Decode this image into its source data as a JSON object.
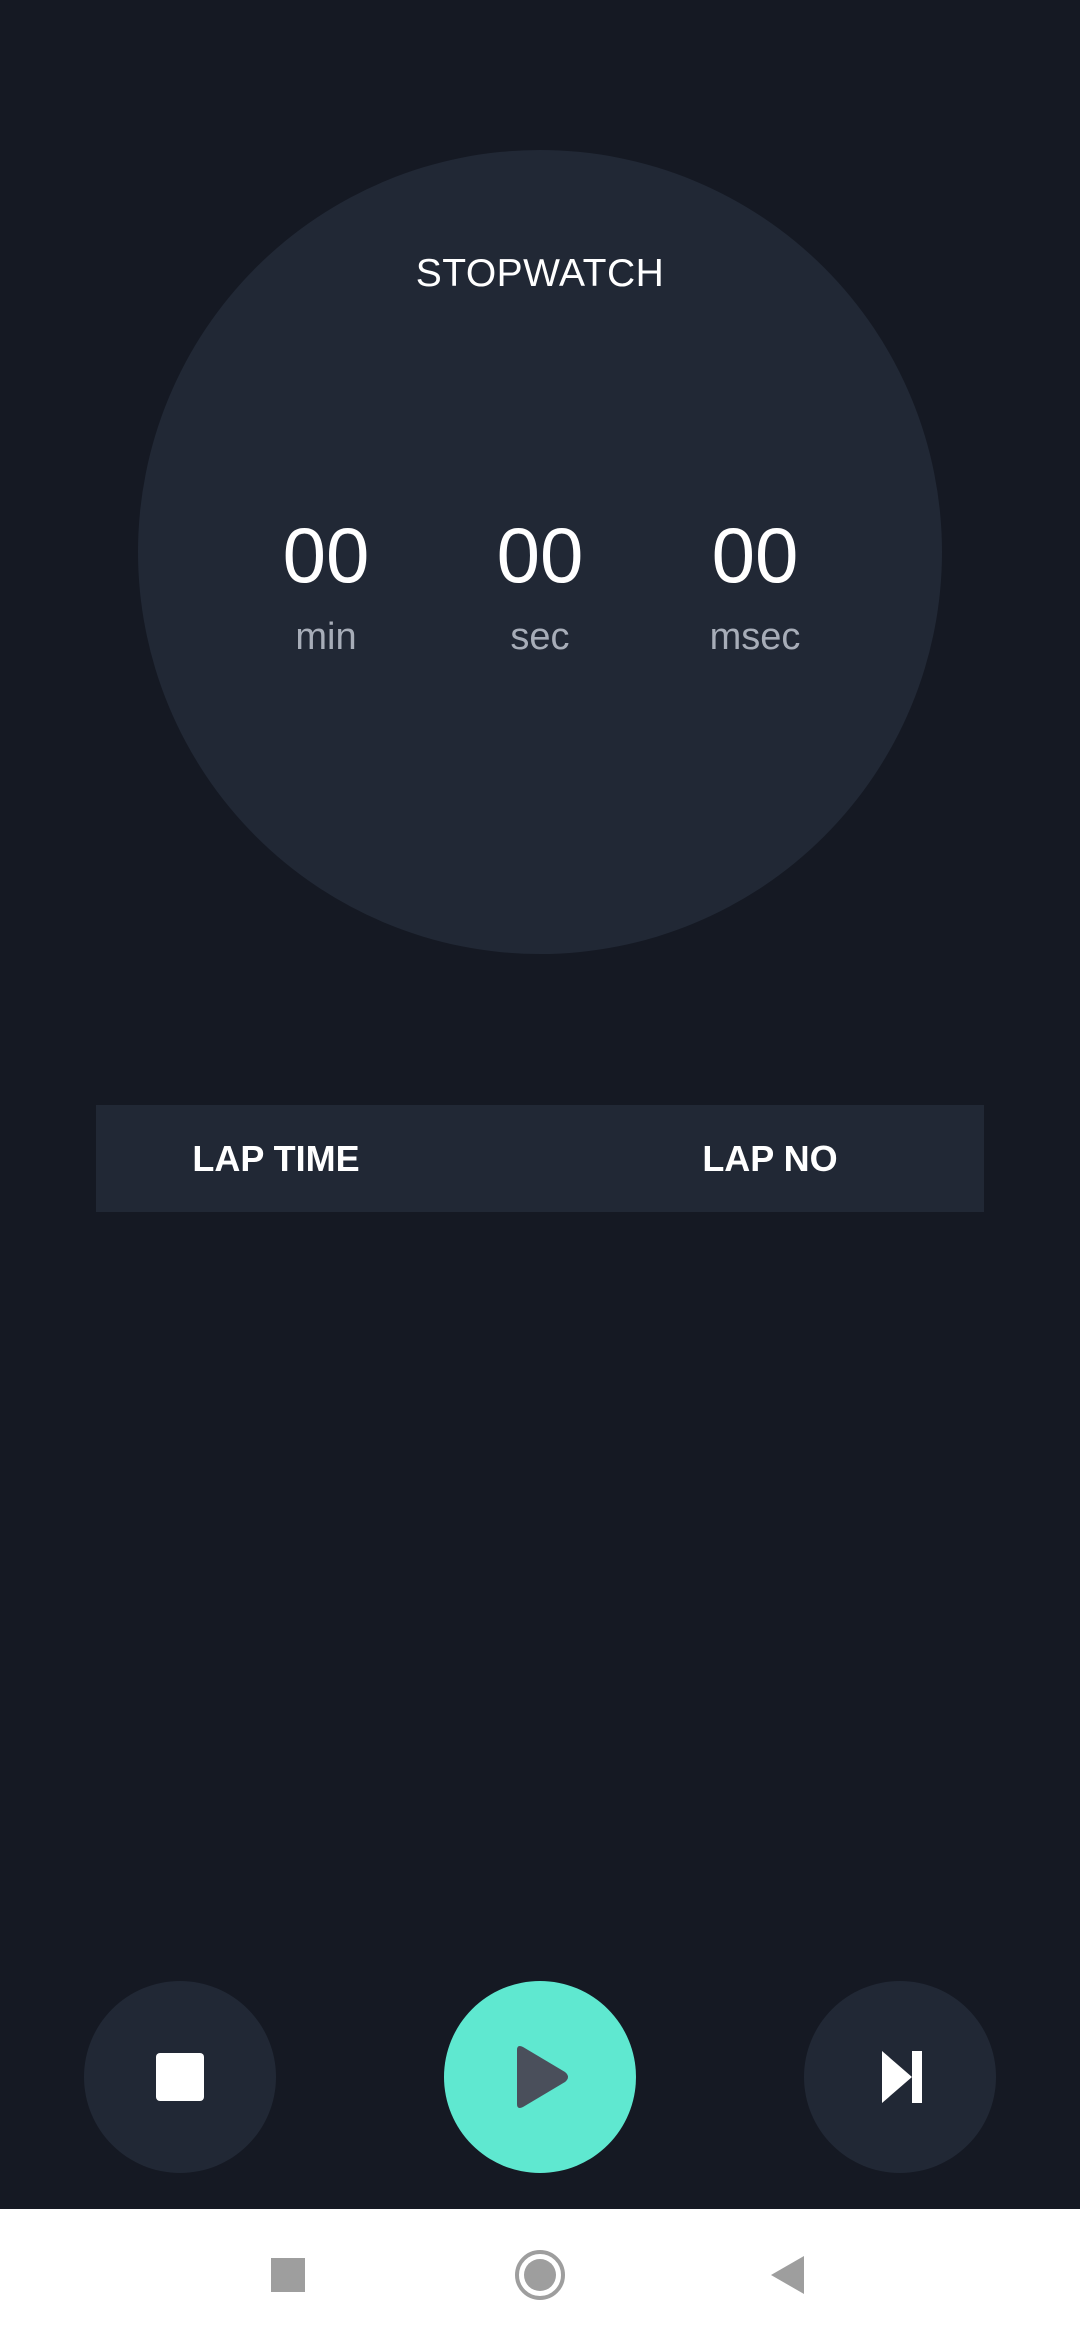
{
  "stopwatch": {
    "title": "STOPWATCH",
    "minutes": "00",
    "minutes_label": "min",
    "seconds": "00",
    "seconds_label": "sec",
    "milliseconds": "00",
    "milliseconds_label": "msec"
  },
  "laps": {
    "col_time": "LAP TIME",
    "col_no": "LAP NO",
    "rows": []
  },
  "controls": {
    "stop_icon": "stop-icon",
    "play_icon": "play-icon",
    "lap_icon": "skip-next-icon"
  },
  "navbar": {
    "recents_icon": "square-icon",
    "home_icon": "circle-icon",
    "back_icon": "triangle-back-icon"
  },
  "colors": {
    "background": "#151923",
    "surface": "#212835",
    "accent": "#5fe8d0",
    "text_primary": "#ffffff",
    "text_secondary": "#a7adb8"
  }
}
